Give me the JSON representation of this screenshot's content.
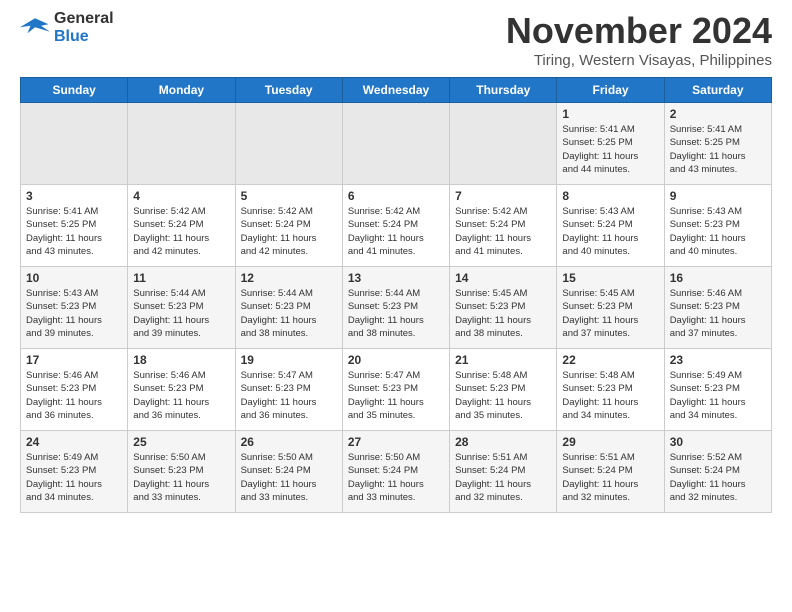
{
  "header": {
    "logo_text_general": "General",
    "logo_text_blue": "Blue",
    "month_title": "November 2024",
    "location": "Tiring, Western Visayas, Philippines"
  },
  "calendar": {
    "days_of_week": [
      "Sunday",
      "Monday",
      "Tuesday",
      "Wednesday",
      "Thursday",
      "Friday",
      "Saturday"
    ],
    "weeks": [
      [
        {
          "num": "",
          "info": "",
          "empty": true
        },
        {
          "num": "",
          "info": "",
          "empty": true
        },
        {
          "num": "",
          "info": "",
          "empty": true
        },
        {
          "num": "",
          "info": "",
          "empty": true
        },
        {
          "num": "",
          "info": "",
          "empty": true
        },
        {
          "num": "1",
          "info": "Sunrise: 5:41 AM\nSunset: 5:25 PM\nDaylight: 11 hours\nand 44 minutes."
        },
        {
          "num": "2",
          "info": "Sunrise: 5:41 AM\nSunset: 5:25 PM\nDaylight: 11 hours\nand 43 minutes."
        }
      ],
      [
        {
          "num": "3",
          "info": "Sunrise: 5:41 AM\nSunset: 5:25 PM\nDaylight: 11 hours\nand 43 minutes."
        },
        {
          "num": "4",
          "info": "Sunrise: 5:42 AM\nSunset: 5:24 PM\nDaylight: 11 hours\nand 42 minutes."
        },
        {
          "num": "5",
          "info": "Sunrise: 5:42 AM\nSunset: 5:24 PM\nDaylight: 11 hours\nand 42 minutes."
        },
        {
          "num": "6",
          "info": "Sunrise: 5:42 AM\nSunset: 5:24 PM\nDaylight: 11 hours\nand 41 minutes."
        },
        {
          "num": "7",
          "info": "Sunrise: 5:42 AM\nSunset: 5:24 PM\nDaylight: 11 hours\nand 41 minutes."
        },
        {
          "num": "8",
          "info": "Sunrise: 5:43 AM\nSunset: 5:24 PM\nDaylight: 11 hours\nand 40 minutes."
        },
        {
          "num": "9",
          "info": "Sunrise: 5:43 AM\nSunset: 5:23 PM\nDaylight: 11 hours\nand 40 minutes."
        }
      ],
      [
        {
          "num": "10",
          "info": "Sunrise: 5:43 AM\nSunset: 5:23 PM\nDaylight: 11 hours\nand 39 minutes."
        },
        {
          "num": "11",
          "info": "Sunrise: 5:44 AM\nSunset: 5:23 PM\nDaylight: 11 hours\nand 39 minutes."
        },
        {
          "num": "12",
          "info": "Sunrise: 5:44 AM\nSunset: 5:23 PM\nDaylight: 11 hours\nand 38 minutes."
        },
        {
          "num": "13",
          "info": "Sunrise: 5:44 AM\nSunset: 5:23 PM\nDaylight: 11 hours\nand 38 minutes."
        },
        {
          "num": "14",
          "info": "Sunrise: 5:45 AM\nSunset: 5:23 PM\nDaylight: 11 hours\nand 38 minutes."
        },
        {
          "num": "15",
          "info": "Sunrise: 5:45 AM\nSunset: 5:23 PM\nDaylight: 11 hours\nand 37 minutes."
        },
        {
          "num": "16",
          "info": "Sunrise: 5:46 AM\nSunset: 5:23 PM\nDaylight: 11 hours\nand 37 minutes."
        }
      ],
      [
        {
          "num": "17",
          "info": "Sunrise: 5:46 AM\nSunset: 5:23 PM\nDaylight: 11 hours\nand 36 minutes."
        },
        {
          "num": "18",
          "info": "Sunrise: 5:46 AM\nSunset: 5:23 PM\nDaylight: 11 hours\nand 36 minutes."
        },
        {
          "num": "19",
          "info": "Sunrise: 5:47 AM\nSunset: 5:23 PM\nDaylight: 11 hours\nand 36 minutes."
        },
        {
          "num": "20",
          "info": "Sunrise: 5:47 AM\nSunset: 5:23 PM\nDaylight: 11 hours\nand 35 minutes."
        },
        {
          "num": "21",
          "info": "Sunrise: 5:48 AM\nSunset: 5:23 PM\nDaylight: 11 hours\nand 35 minutes."
        },
        {
          "num": "22",
          "info": "Sunrise: 5:48 AM\nSunset: 5:23 PM\nDaylight: 11 hours\nand 34 minutes."
        },
        {
          "num": "23",
          "info": "Sunrise: 5:49 AM\nSunset: 5:23 PM\nDaylight: 11 hours\nand 34 minutes."
        }
      ],
      [
        {
          "num": "24",
          "info": "Sunrise: 5:49 AM\nSunset: 5:23 PM\nDaylight: 11 hours\nand 34 minutes."
        },
        {
          "num": "25",
          "info": "Sunrise: 5:50 AM\nSunset: 5:23 PM\nDaylight: 11 hours\nand 33 minutes."
        },
        {
          "num": "26",
          "info": "Sunrise: 5:50 AM\nSunset: 5:24 PM\nDaylight: 11 hours\nand 33 minutes."
        },
        {
          "num": "27",
          "info": "Sunrise: 5:50 AM\nSunset: 5:24 PM\nDaylight: 11 hours\nand 33 minutes."
        },
        {
          "num": "28",
          "info": "Sunrise: 5:51 AM\nSunset: 5:24 PM\nDaylight: 11 hours\nand 32 minutes."
        },
        {
          "num": "29",
          "info": "Sunrise: 5:51 AM\nSunset: 5:24 PM\nDaylight: 11 hours\nand 32 minutes."
        },
        {
          "num": "30",
          "info": "Sunrise: 5:52 AM\nSunset: 5:24 PM\nDaylight: 11 hours\nand 32 minutes."
        }
      ]
    ]
  }
}
